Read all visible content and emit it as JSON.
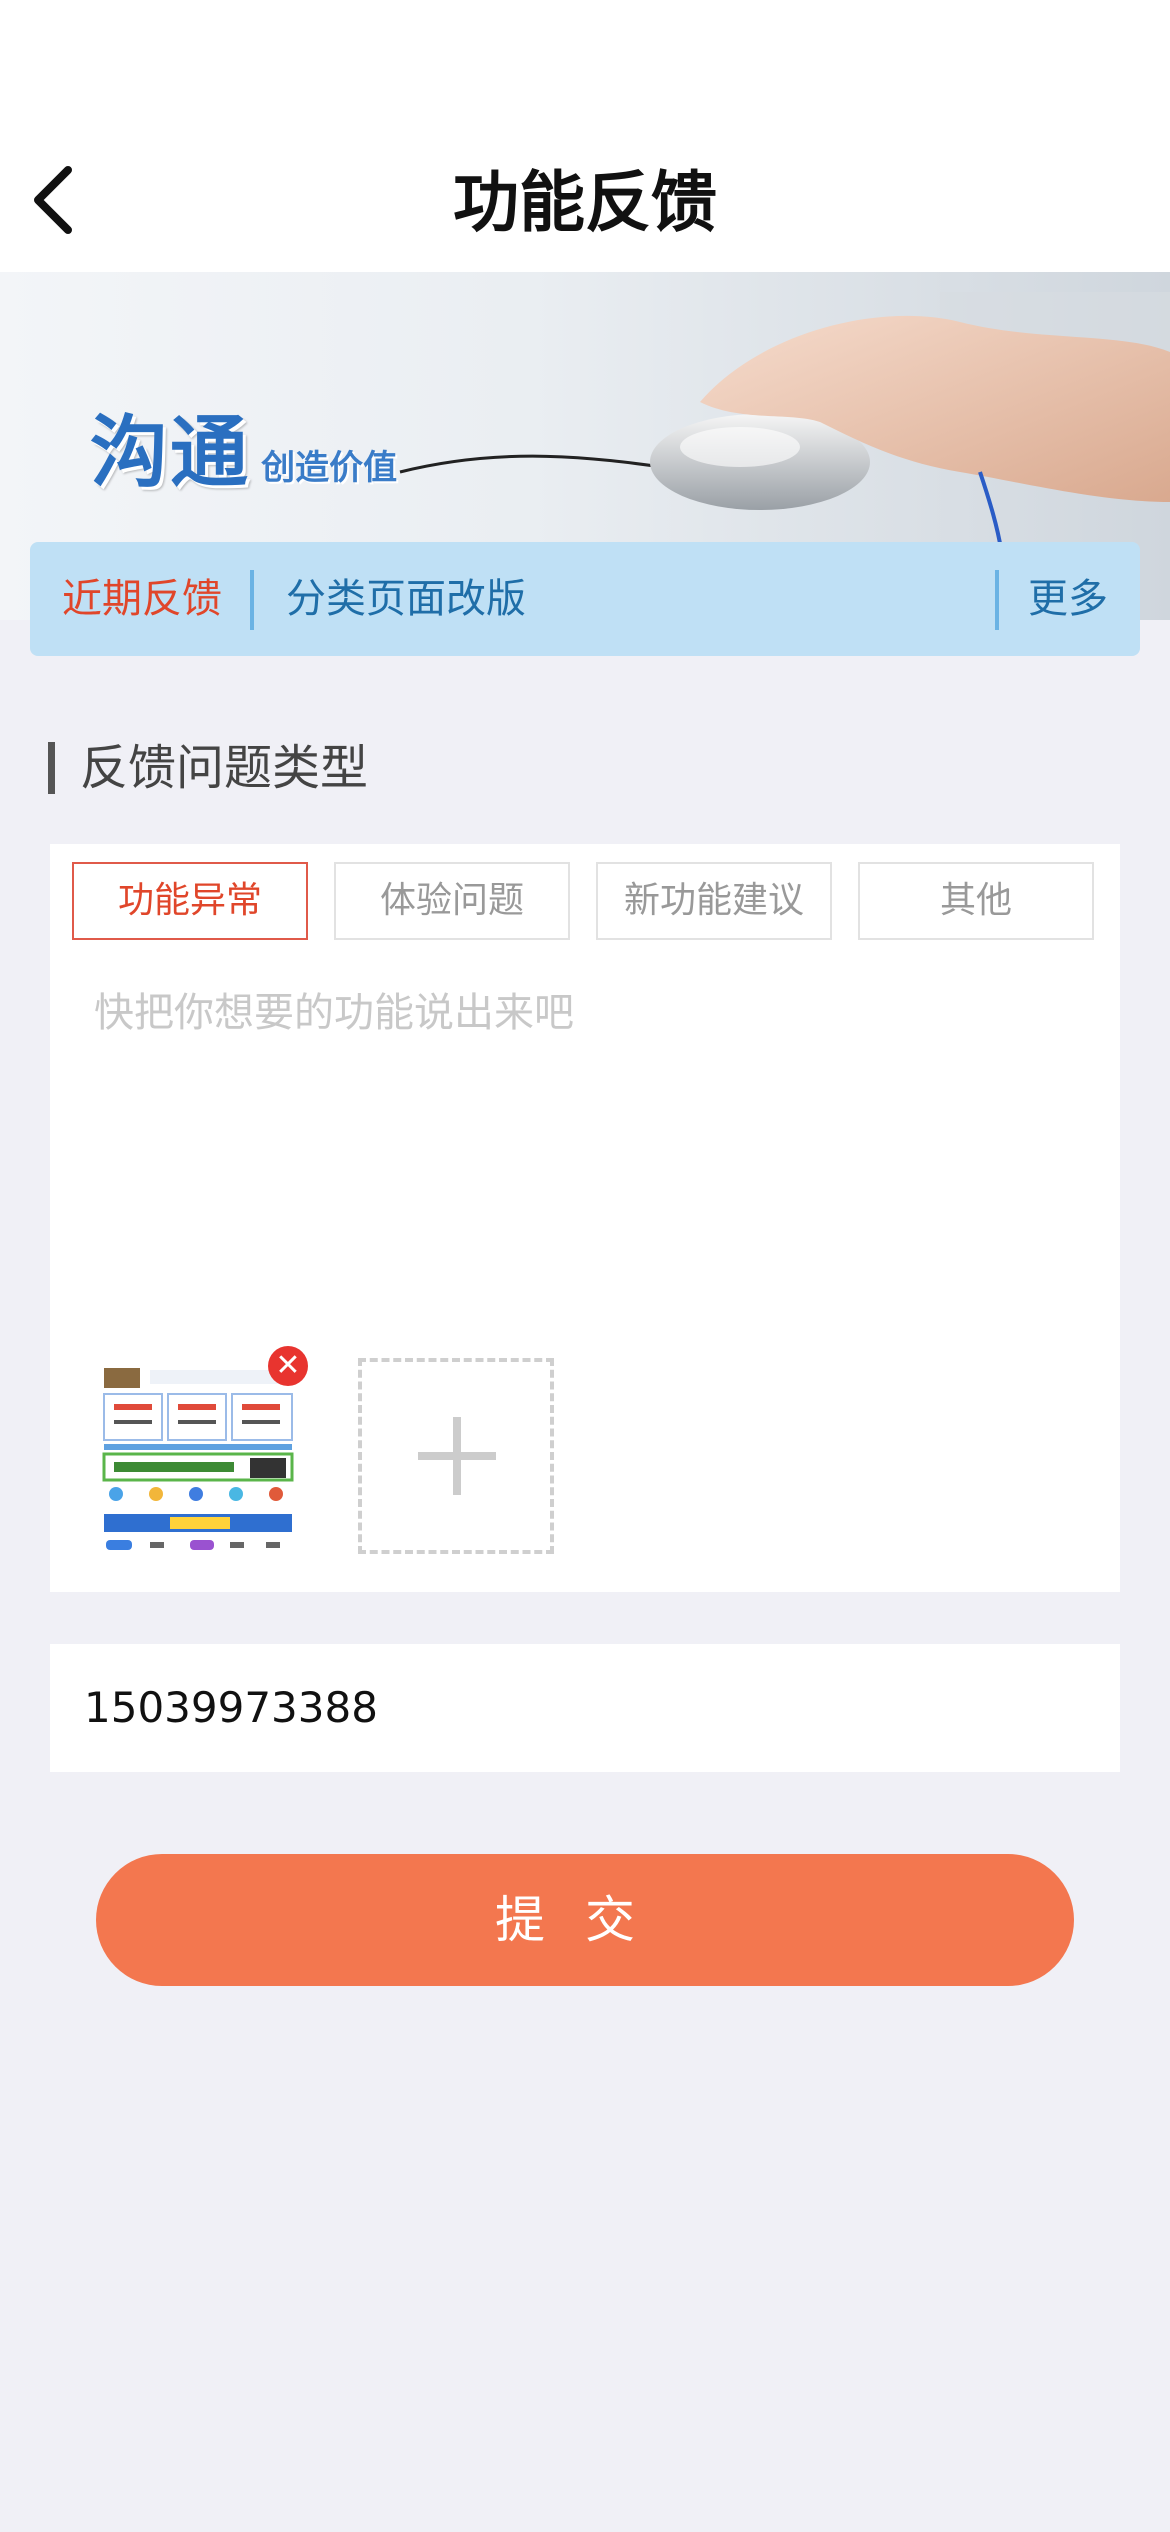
{
  "header": {
    "title": "功能反馈",
    "back_icon": "back-chevron-icon"
  },
  "banner": {
    "main_text": "沟通",
    "sub_text": "创造价值"
  },
  "notice": {
    "label": "近期反馈",
    "item": "分类页面改版",
    "more": "更多"
  },
  "section": {
    "title": "反馈问题类型"
  },
  "tabs": [
    {
      "label": "功能异常",
      "active": true
    },
    {
      "label": "体验问题",
      "active": false
    },
    {
      "label": "新功能建议",
      "active": false
    },
    {
      "label": "其他",
      "active": false
    }
  ],
  "feedback": {
    "placeholder": "快把你想要的功能说出来吧",
    "value": ""
  },
  "attachments": {
    "remove_icon": "close-icon",
    "add_icon": "plus-icon"
  },
  "contact": {
    "value": "15039973388"
  },
  "submit": {
    "label": "提交"
  },
  "colors": {
    "accent": "#f3774f",
    "active_tab": "#e0462a",
    "notice_bg": "#bfe0f5",
    "page_bg": "#f0f0f6"
  }
}
